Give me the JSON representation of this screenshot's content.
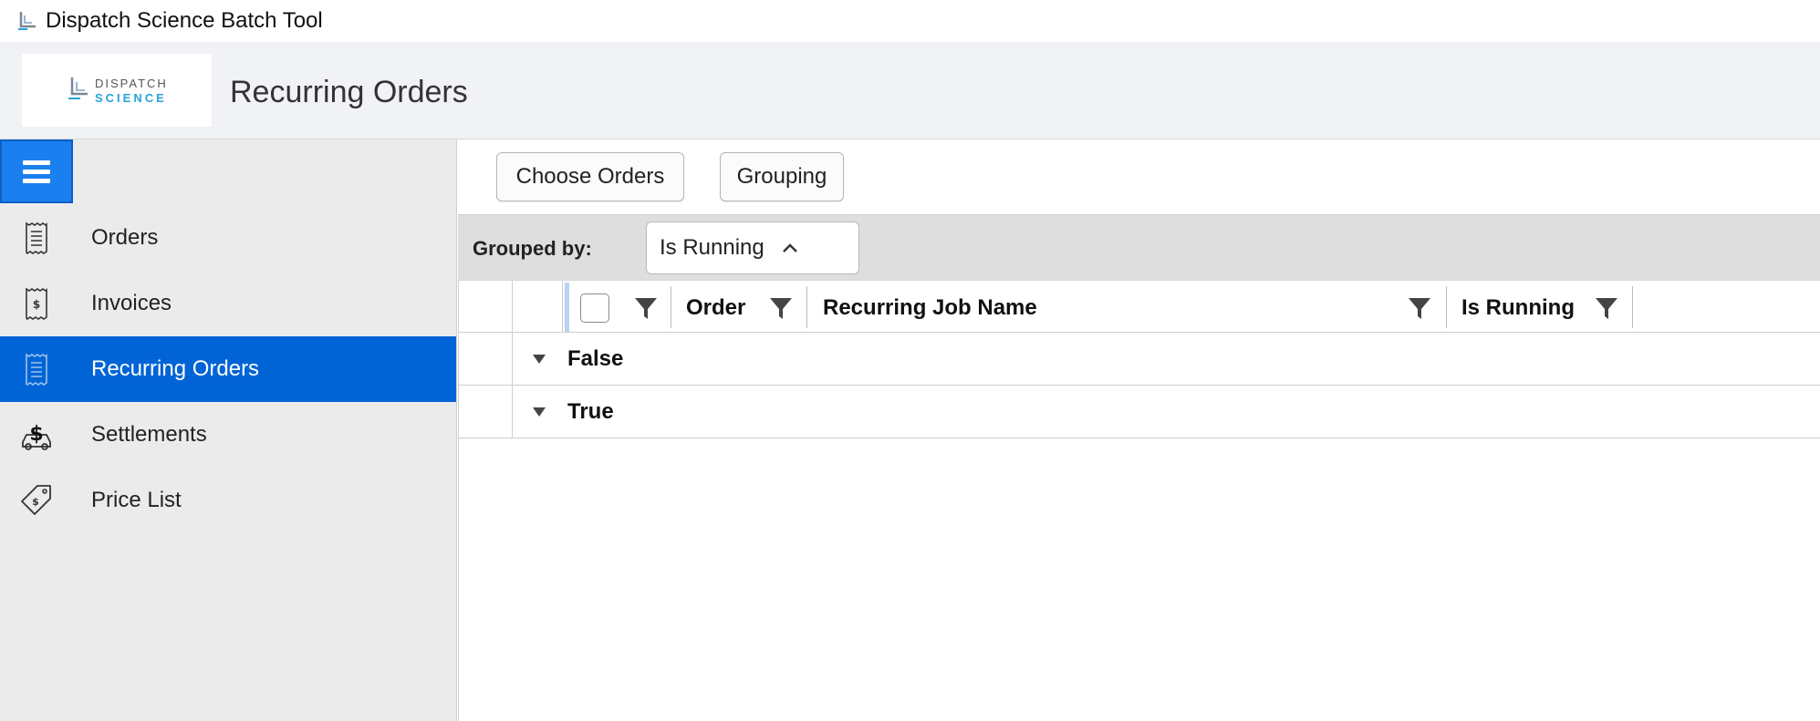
{
  "window": {
    "title": "Dispatch Science Batch Tool"
  },
  "header": {
    "logo": {
      "line1": "DISPATCH",
      "line2": "SCIENCE"
    },
    "page_title": "Recurring Orders"
  },
  "sidebar": {
    "items": [
      {
        "label": "Orders",
        "icon": "receipt-icon",
        "active": false
      },
      {
        "label": "Invoices",
        "icon": "invoice-dollar-icon",
        "active": false
      },
      {
        "label": "Recurring Orders",
        "icon": "receipt-icon",
        "active": true
      },
      {
        "label": "Settlements",
        "icon": "settlement-dollar-icon",
        "active": false
      },
      {
        "label": "Price List",
        "icon": "price-tag-icon",
        "active": false
      }
    ]
  },
  "toolbar": {
    "choose_orders_label": "Choose Orders",
    "grouping_label": "Grouping"
  },
  "grouping": {
    "label": "Grouped by:",
    "group_field": "Is Running"
  },
  "grid": {
    "columns": [
      {
        "label": "Order"
      },
      {
        "label": "Recurring Job Name"
      },
      {
        "label": "Is Running"
      }
    ],
    "groups": [
      {
        "label": "False"
      },
      {
        "label": "True"
      }
    ]
  },
  "colors": {
    "accent": "#0064d6",
    "menu_button": "#1a7ff0",
    "logo_blue": "#2aa3d8"
  }
}
